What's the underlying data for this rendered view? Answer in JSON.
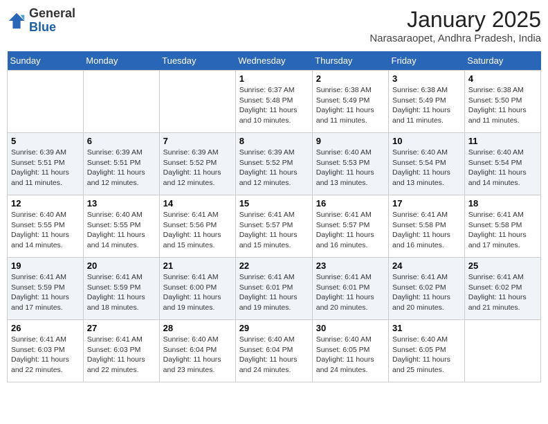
{
  "header": {
    "logo_general": "General",
    "logo_blue": "Blue",
    "month": "January 2025",
    "location": "Narasaraopet, Andhra Pradesh, India"
  },
  "weekdays": [
    "Sunday",
    "Monday",
    "Tuesday",
    "Wednesday",
    "Thursday",
    "Friday",
    "Saturday"
  ],
  "weeks": [
    [
      {
        "day": "",
        "info": ""
      },
      {
        "day": "",
        "info": ""
      },
      {
        "day": "",
        "info": ""
      },
      {
        "day": "1",
        "info": "Sunrise: 6:37 AM\nSunset: 5:48 PM\nDaylight: 11 hours and 10 minutes."
      },
      {
        "day": "2",
        "info": "Sunrise: 6:38 AM\nSunset: 5:49 PM\nDaylight: 11 hours and 11 minutes."
      },
      {
        "day": "3",
        "info": "Sunrise: 6:38 AM\nSunset: 5:49 PM\nDaylight: 11 hours and 11 minutes."
      },
      {
        "day": "4",
        "info": "Sunrise: 6:38 AM\nSunset: 5:50 PM\nDaylight: 11 hours and 11 minutes."
      }
    ],
    [
      {
        "day": "5",
        "info": "Sunrise: 6:39 AM\nSunset: 5:51 PM\nDaylight: 11 hours and 11 minutes."
      },
      {
        "day": "6",
        "info": "Sunrise: 6:39 AM\nSunset: 5:51 PM\nDaylight: 11 hours and 12 minutes."
      },
      {
        "day": "7",
        "info": "Sunrise: 6:39 AM\nSunset: 5:52 PM\nDaylight: 11 hours and 12 minutes."
      },
      {
        "day": "8",
        "info": "Sunrise: 6:39 AM\nSunset: 5:52 PM\nDaylight: 11 hours and 12 minutes."
      },
      {
        "day": "9",
        "info": "Sunrise: 6:40 AM\nSunset: 5:53 PM\nDaylight: 11 hours and 13 minutes."
      },
      {
        "day": "10",
        "info": "Sunrise: 6:40 AM\nSunset: 5:54 PM\nDaylight: 11 hours and 13 minutes."
      },
      {
        "day": "11",
        "info": "Sunrise: 6:40 AM\nSunset: 5:54 PM\nDaylight: 11 hours and 14 minutes."
      }
    ],
    [
      {
        "day": "12",
        "info": "Sunrise: 6:40 AM\nSunset: 5:55 PM\nDaylight: 11 hours and 14 minutes."
      },
      {
        "day": "13",
        "info": "Sunrise: 6:40 AM\nSunset: 5:55 PM\nDaylight: 11 hours and 14 minutes."
      },
      {
        "day": "14",
        "info": "Sunrise: 6:41 AM\nSunset: 5:56 PM\nDaylight: 11 hours and 15 minutes."
      },
      {
        "day": "15",
        "info": "Sunrise: 6:41 AM\nSunset: 5:57 PM\nDaylight: 11 hours and 15 minutes."
      },
      {
        "day": "16",
        "info": "Sunrise: 6:41 AM\nSunset: 5:57 PM\nDaylight: 11 hours and 16 minutes."
      },
      {
        "day": "17",
        "info": "Sunrise: 6:41 AM\nSunset: 5:58 PM\nDaylight: 11 hours and 16 minutes."
      },
      {
        "day": "18",
        "info": "Sunrise: 6:41 AM\nSunset: 5:58 PM\nDaylight: 11 hours and 17 minutes."
      }
    ],
    [
      {
        "day": "19",
        "info": "Sunrise: 6:41 AM\nSunset: 5:59 PM\nDaylight: 11 hours and 17 minutes."
      },
      {
        "day": "20",
        "info": "Sunrise: 6:41 AM\nSunset: 5:59 PM\nDaylight: 11 hours and 18 minutes."
      },
      {
        "day": "21",
        "info": "Sunrise: 6:41 AM\nSunset: 6:00 PM\nDaylight: 11 hours and 19 minutes."
      },
      {
        "day": "22",
        "info": "Sunrise: 6:41 AM\nSunset: 6:01 PM\nDaylight: 11 hours and 19 minutes."
      },
      {
        "day": "23",
        "info": "Sunrise: 6:41 AM\nSunset: 6:01 PM\nDaylight: 11 hours and 20 minutes."
      },
      {
        "day": "24",
        "info": "Sunrise: 6:41 AM\nSunset: 6:02 PM\nDaylight: 11 hours and 20 minutes."
      },
      {
        "day": "25",
        "info": "Sunrise: 6:41 AM\nSunset: 6:02 PM\nDaylight: 11 hours and 21 minutes."
      }
    ],
    [
      {
        "day": "26",
        "info": "Sunrise: 6:41 AM\nSunset: 6:03 PM\nDaylight: 11 hours and 22 minutes."
      },
      {
        "day": "27",
        "info": "Sunrise: 6:41 AM\nSunset: 6:03 PM\nDaylight: 11 hours and 22 minutes."
      },
      {
        "day": "28",
        "info": "Sunrise: 6:40 AM\nSunset: 6:04 PM\nDaylight: 11 hours and 23 minutes."
      },
      {
        "day": "29",
        "info": "Sunrise: 6:40 AM\nSunset: 6:04 PM\nDaylight: 11 hours and 24 minutes."
      },
      {
        "day": "30",
        "info": "Sunrise: 6:40 AM\nSunset: 6:05 PM\nDaylight: 11 hours and 24 minutes."
      },
      {
        "day": "31",
        "info": "Sunrise: 6:40 AM\nSunset: 6:05 PM\nDaylight: 11 hours and 25 minutes."
      },
      {
        "day": "",
        "info": ""
      }
    ]
  ]
}
